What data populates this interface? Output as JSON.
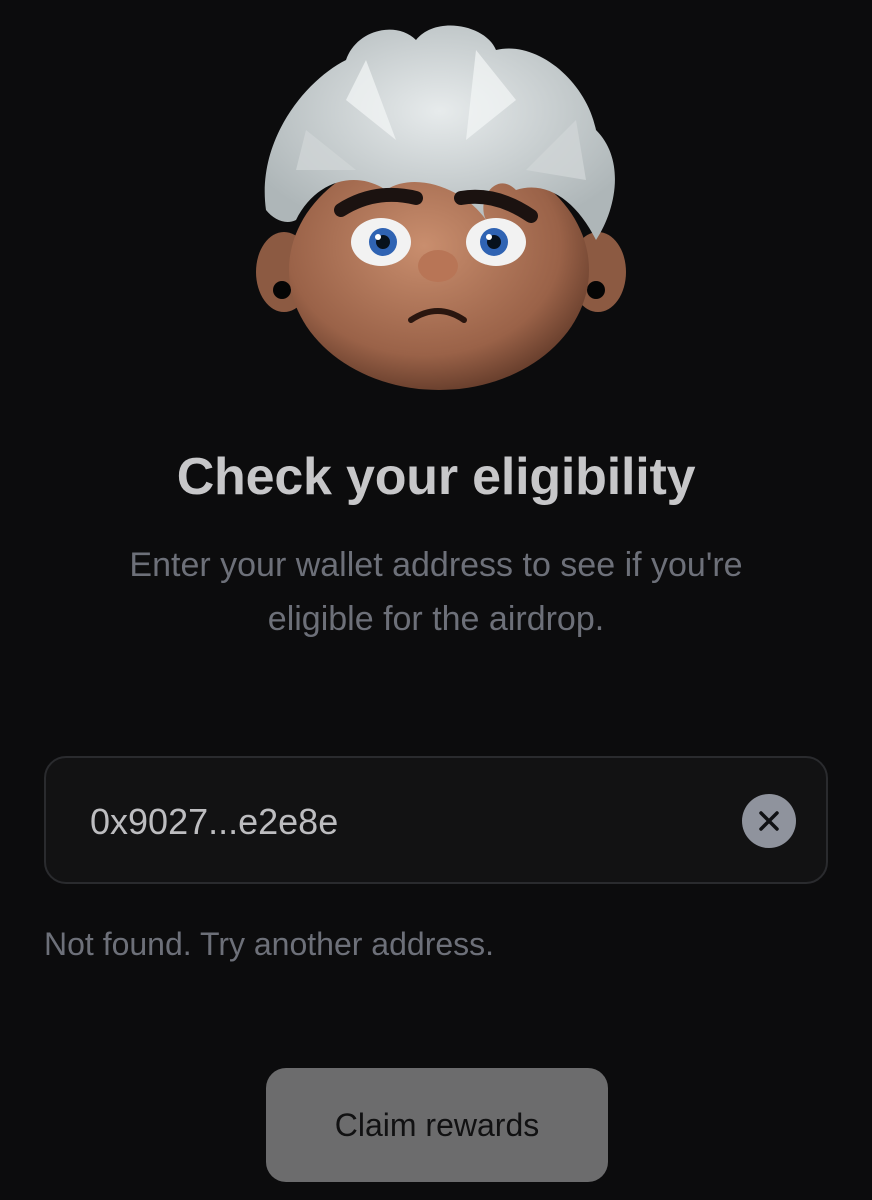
{
  "header": {
    "avatar_icon": "sad-avatar-icon"
  },
  "main": {
    "title": "Check your eligibility",
    "subtitle": "Enter your wallet address to see if you're eligible for the airdrop."
  },
  "address_input": {
    "value": "0x9027...e2e8e",
    "clear_icon": "close-icon"
  },
  "status": {
    "message": "Not found. Try another address."
  },
  "actions": {
    "claim_label": "Claim rewards"
  },
  "colors": {
    "background": "#0c0c0d",
    "title": "#c7c7c9",
    "muted_text": "#6d7079",
    "input_border": "#2a2b2e",
    "clear_button": "#8f939d",
    "claim_button": "#6c6c6d"
  }
}
